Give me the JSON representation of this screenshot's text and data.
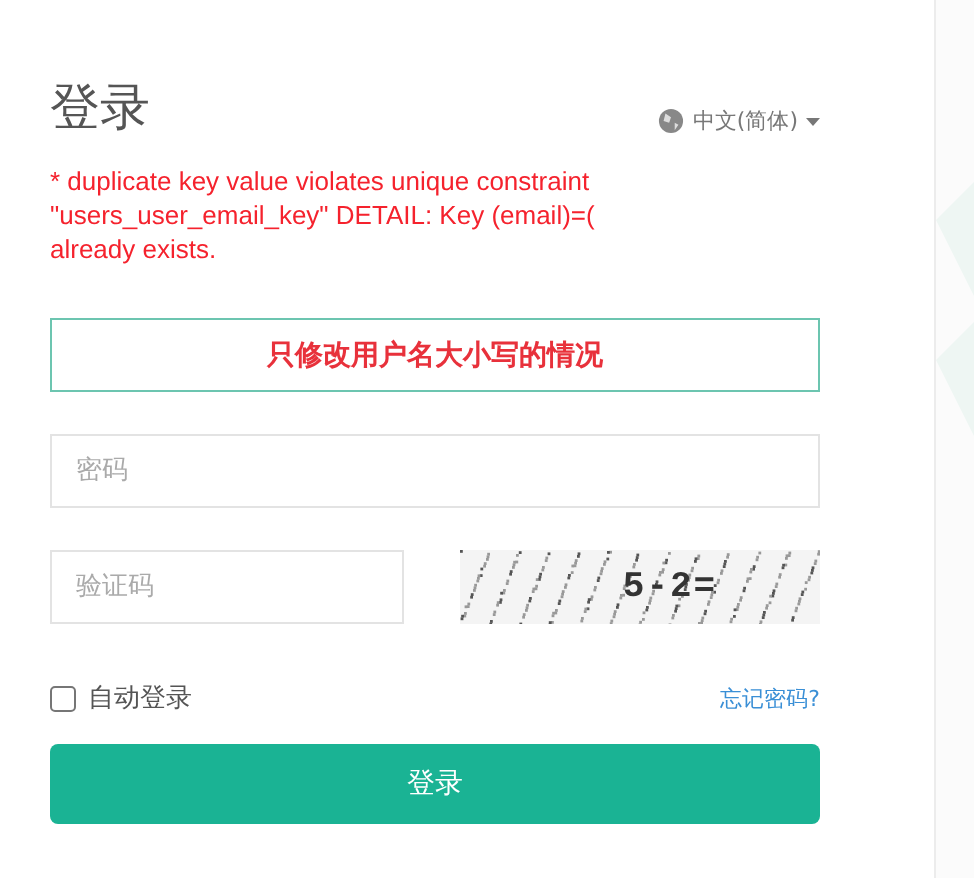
{
  "title": "登录",
  "language": {
    "label": "中文(简体)"
  },
  "error": {
    "before": "* duplicate key value violates unique constraint \"users_user_email_key\" DETAIL: Key (email)=(",
    "after": "already exists."
  },
  "username": {
    "annotation": "只修改用户名大小写的情况"
  },
  "password": {
    "placeholder": "密码"
  },
  "captcha": {
    "placeholder": "验证码",
    "image_text": "5-2="
  },
  "remember": {
    "label": "自动登录",
    "checked": false
  },
  "forgot_link": "忘记密码?",
  "submit": "登录"
}
